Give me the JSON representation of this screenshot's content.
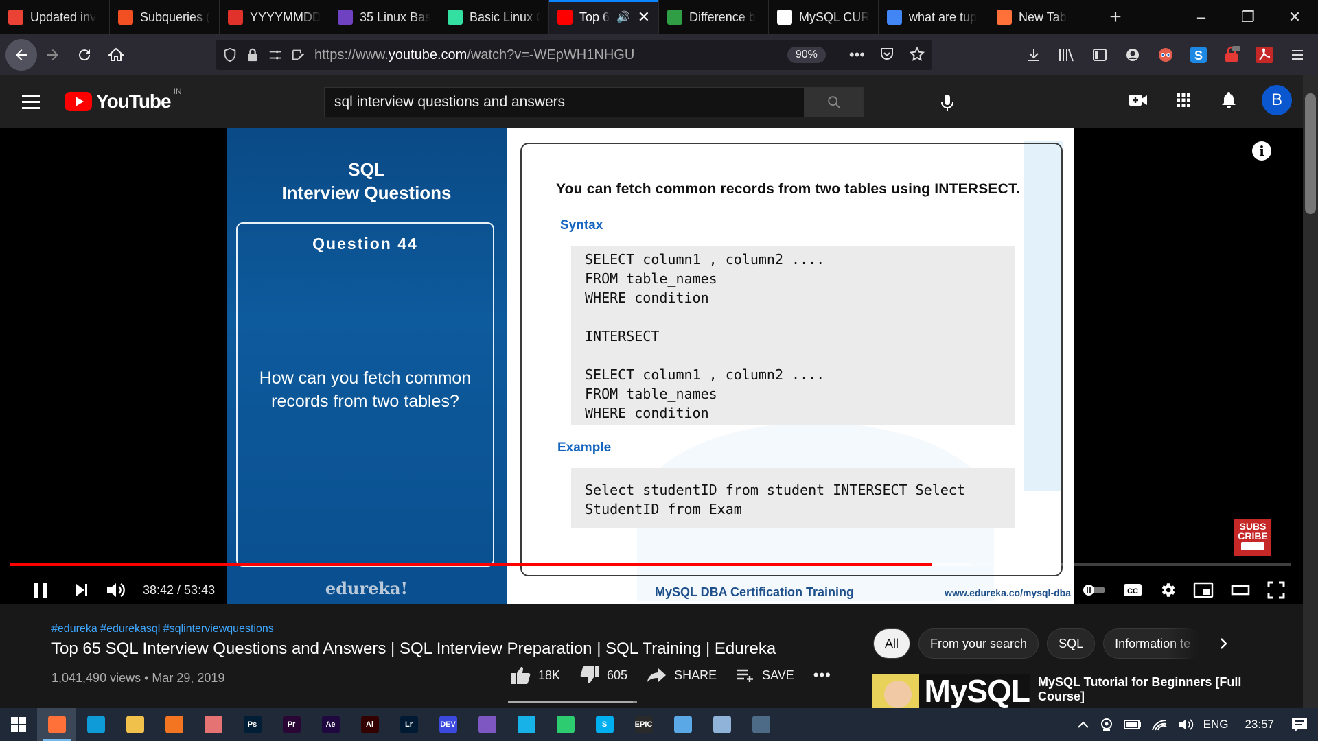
{
  "browser": {
    "tabs": [
      {
        "title": "Updated inv",
        "favicon": "gmail-icon",
        "color": "#ea4335",
        "active": false
      },
      {
        "title": "Subqueries (",
        "favicon": "microsoft-icon",
        "color": "#f25022",
        "active": false
      },
      {
        "title": "YYYYMMDD",
        "favicon": "search-tab-icon",
        "color": "#e0322b",
        "active": false
      },
      {
        "title": "35 Linux Bas",
        "favicon": "linux-site-icon",
        "color": "#6f42c1",
        "active": false
      },
      {
        "title": "Basic Linux C",
        "favicon": "tripadvisor-style-icon",
        "color": "#34e0a1",
        "active": false
      },
      {
        "title": "Top 6",
        "favicon": "youtube-icon",
        "color": "#ff0000",
        "active": true
      },
      {
        "title": "Difference b",
        "favicon": "link-icon",
        "color": "#2f9e44",
        "active": false
      },
      {
        "title": "MySQL CUR",
        "favicon": "w3schools-icon",
        "color": "#ffffff",
        "active": false
      },
      {
        "title": "what are tup",
        "favicon": "google-icon",
        "color": "#4285f4",
        "active": false
      },
      {
        "title": "New Tab",
        "favicon": "firefox-icon",
        "color": "#ff7139",
        "active": false
      }
    ],
    "url_prefix": "https://www.",
    "url_domain": "youtube.com",
    "url_path": "/watch?v=-WEpWH1NHGU",
    "zoom": "90%"
  },
  "youtube": {
    "region": "IN",
    "search_query": "sql interview questions and answers",
    "avatar_letter": "B"
  },
  "slide": {
    "title_line1": "SQL",
    "title_line2": "Interview Questions",
    "question_number": "Question 44",
    "question_text": "How can you fetch common records from two tables?",
    "brand": "edureka!",
    "intro": "You can fetch common records from two tables using INTERSECT.",
    "syntax_heading": "Syntax",
    "syntax_code": "SELECT column1 , column2 ....\nFROM table_names\nWHERE condition\n\nINTERSECT\n\nSELECT column1 , column2 ....\nFROM table_names\nWHERE condition",
    "example_heading": "Example",
    "example_code": "Select studentID from student INTERSECT Select\nStudentID from Exam",
    "course": "MySQL DBA Certification Training",
    "site": "www.edureka.co/mysql-dba",
    "subscribe_text": "SUBS\nCRIBE"
  },
  "player": {
    "current_time": "38:42",
    "duration": "53:43",
    "time_display": "38:42 / 53:43",
    "played_fraction": 0.7205,
    "loaded_fraction": 0.75
  },
  "video": {
    "hashtags": "#edureka #edurekasql #sqlinterviewquestions",
    "title": "Top 65 SQL Interview Questions and Answers | SQL Interview Preparation | SQL Training | Edureka",
    "meta": "1,041,490 views • Mar 29, 2019",
    "likes": "18K",
    "dislikes": "605",
    "share_label": "SHARE",
    "save_label": "SAVE",
    "like_ratio": 0.967
  },
  "chips": [
    "All",
    "From your search",
    "SQL",
    "Information te"
  ],
  "recommendation": {
    "thumb_text": "MySQL",
    "title": "MySQL Tutorial for Beginners [Full Course]"
  },
  "taskbar": {
    "apps": [
      {
        "name": "firefox-taskbar-icon",
        "label": "",
        "color": "#ff7139",
        "active": true
      },
      {
        "name": "edge-taskbar-icon",
        "label": "",
        "color": "#0f9bd7",
        "active": false
      },
      {
        "name": "file-explorer-taskbar-icon",
        "label": "",
        "color": "#f0c14b",
        "active": false
      },
      {
        "name": "crunchyroll-taskbar-icon",
        "label": "",
        "color": "#f47521",
        "active": false
      },
      {
        "name": "brain-app-taskbar-icon",
        "label": "",
        "color": "#e57373",
        "active": false
      },
      {
        "name": "photoshop-taskbar-icon",
        "label": "Ps",
        "color": "#001e36",
        "active": false
      },
      {
        "name": "premiere-taskbar-icon",
        "label": "Pr",
        "color": "#2a0634",
        "active": false
      },
      {
        "name": "after-effects-taskbar-icon",
        "label": "Ae",
        "color": "#1f0740",
        "active": false
      },
      {
        "name": "illustrator-taskbar-icon",
        "label": "Ai",
        "color": "#330000",
        "active": false
      },
      {
        "name": "lightroom-taskbar-icon",
        "label": "Lr",
        "color": "#001a33",
        "active": false
      },
      {
        "name": "dev-taskbar-icon",
        "label": "DEV",
        "color": "#3b49df",
        "active": false
      },
      {
        "name": "cube-app-taskbar-icon",
        "label": "",
        "color": "#7e57c2",
        "active": false
      },
      {
        "name": "kodi-taskbar-icon",
        "label": "",
        "color": "#17b2e7",
        "active": false
      },
      {
        "name": "spinner-app-taskbar-icon",
        "label": "",
        "color": "#2ecc71",
        "active": false
      },
      {
        "name": "skype-taskbar-icon",
        "label": "S",
        "color": "#00aff0",
        "active": false
      },
      {
        "name": "epic-games-taskbar-icon",
        "label": "EPIC",
        "color": "#2a2a2a",
        "active": false
      },
      {
        "name": "notepad-taskbar-icon",
        "label": "",
        "color": "#5aa9e6",
        "active": false
      },
      {
        "name": "edit-app-taskbar-icon",
        "label": "",
        "color": "#8fb3d9",
        "active": false
      },
      {
        "name": "mysql-workbench-taskbar-icon",
        "label": "",
        "color": "#4d6a87",
        "active": false
      }
    ],
    "language": "ENG",
    "time": "23:57"
  },
  "colors": {
    "accent_blue": "#0a84ff",
    "youtube_red": "#ff0000",
    "slide_heading_blue": "#1565c0"
  }
}
